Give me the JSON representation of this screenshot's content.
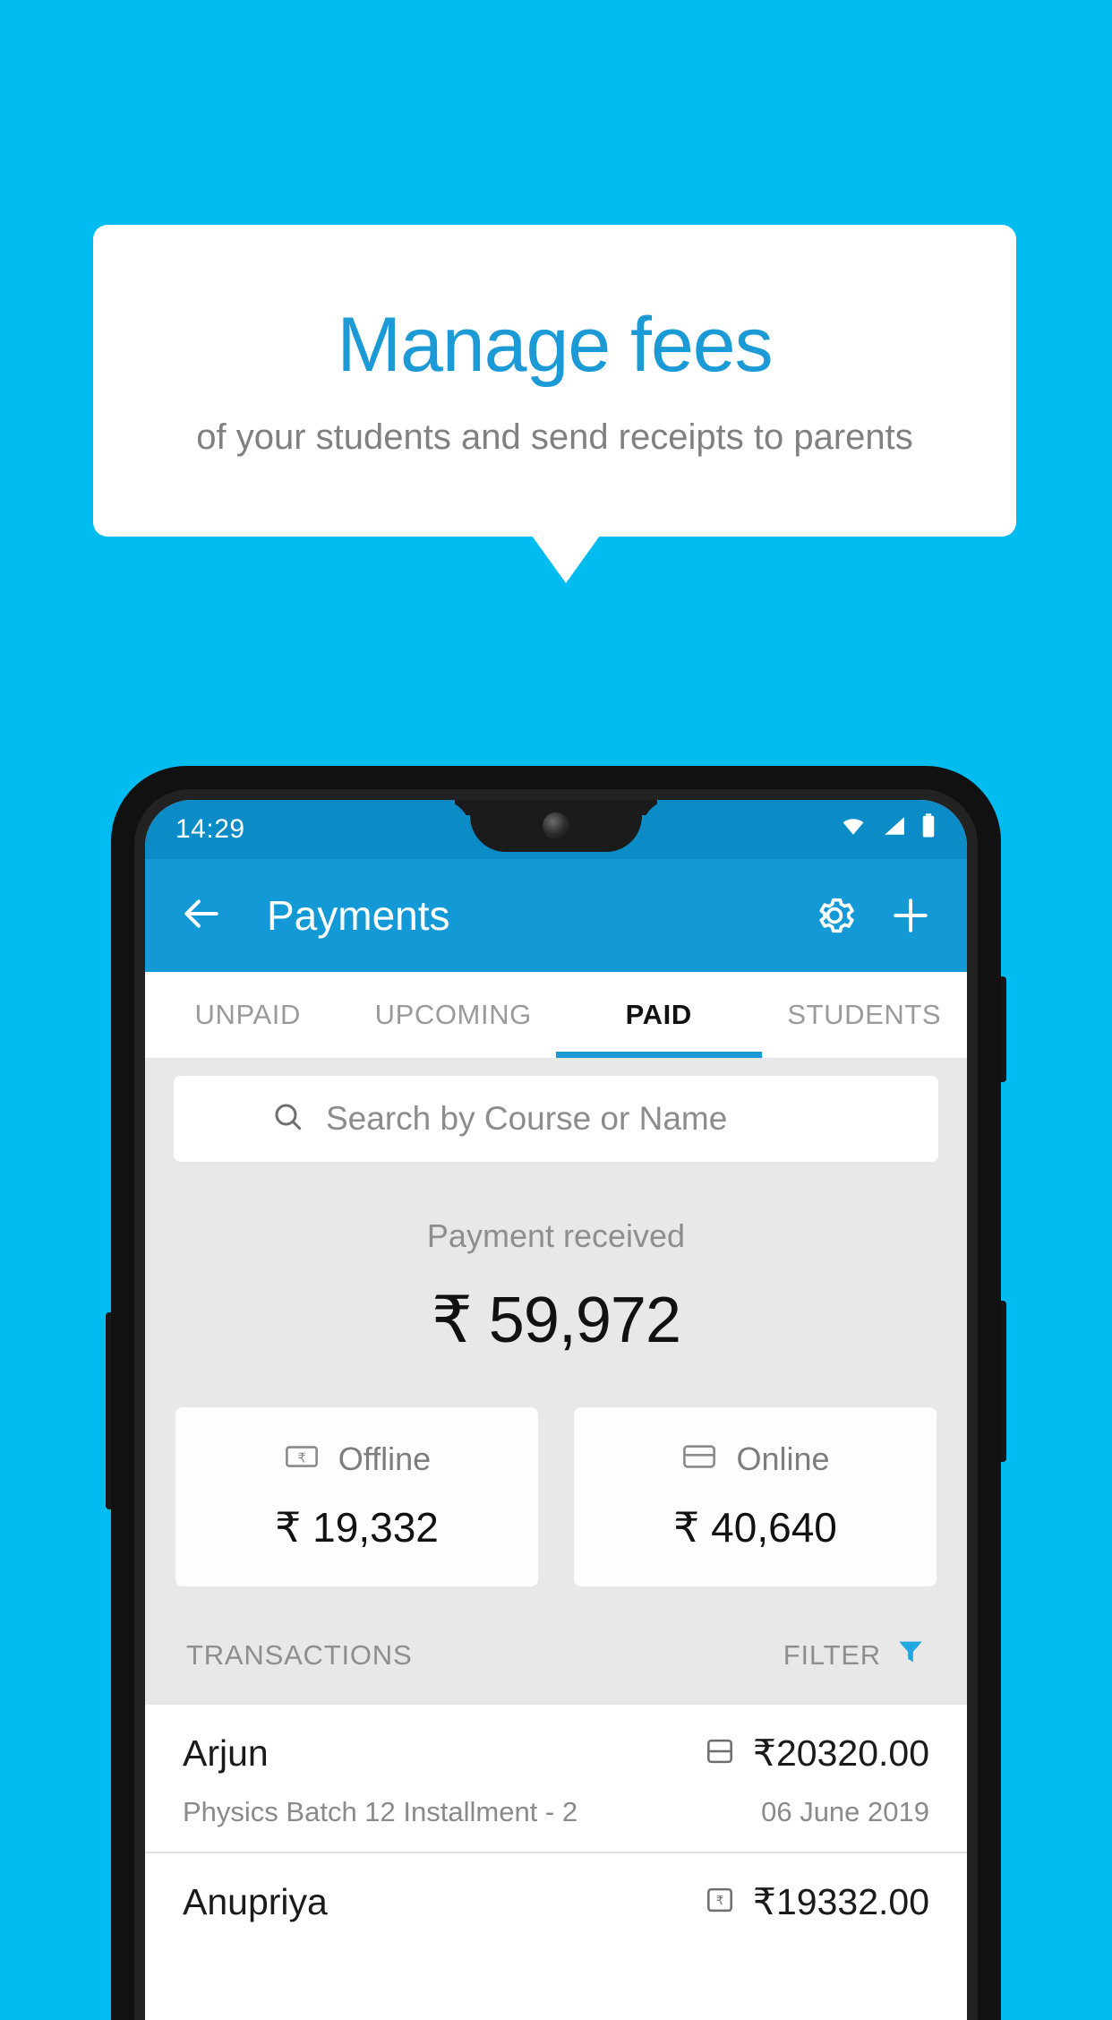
{
  "promo": {
    "title": "Manage fees",
    "subtitle": "of your students and send receipts to parents",
    "title_color": "#1b9ad6",
    "background_color": "#00bcf0"
  },
  "status_bar": {
    "time": "14:29",
    "icons": [
      "wifi-icon",
      "signal-icon",
      "battery-icon"
    ]
  },
  "app_bar": {
    "back_label": "back-arrow-icon",
    "title": "Payments",
    "settings_label": "gear-icon",
    "add_label": "plus-icon",
    "color": "#139ad6"
  },
  "tabs": [
    {
      "label": "UNPAID",
      "active": false
    },
    {
      "label": "UPCOMING",
      "active": false
    },
    {
      "label": "PAID",
      "active": true
    },
    {
      "label": "STUDENTS",
      "active": false
    }
  ],
  "search": {
    "placeholder": "Search by Course or Name",
    "value": ""
  },
  "summary": {
    "label": "Payment received",
    "amount": "₹ 59,972"
  },
  "methods": [
    {
      "label": "Offline",
      "amount": "₹ 19,332",
      "icon": "cash-note-icon"
    },
    {
      "label": "Online",
      "amount": "₹ 40,640",
      "icon": "credit-card-icon"
    }
  ],
  "section": {
    "transactions_label": "TRANSACTIONS",
    "filter_label": "FILTER",
    "filter_icon_color": "#21a8e0"
  },
  "transactions": [
    {
      "name": "Arjun",
      "amount": "₹20320.00",
      "description": "Physics Batch 12 Installment - 2",
      "date": "06 June 2019",
      "method_icon": "credit-card-icon"
    },
    {
      "name": "Anupriya",
      "amount": "₹19332.00",
      "description": "",
      "date": "",
      "method_icon": "cash-note-icon"
    }
  ]
}
